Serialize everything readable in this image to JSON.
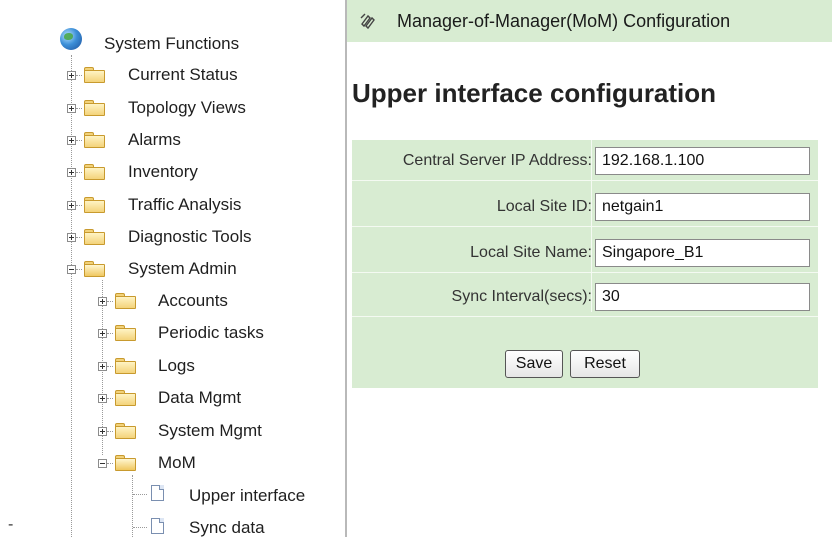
{
  "tree": {
    "root": "System Functions",
    "items": [
      {
        "label": "Current Status"
      },
      {
        "label": "Topology Views"
      },
      {
        "label": "Alarms"
      },
      {
        "label": "Inventory"
      },
      {
        "label": "Traffic Analysis"
      },
      {
        "label": "Diagnostic Tools"
      },
      {
        "label": "System Admin"
      }
    ],
    "system_admin_children": [
      {
        "label": "Accounts"
      },
      {
        "label": "Periodic tasks"
      },
      {
        "label": "Logs"
      },
      {
        "label": "Data Mgmt"
      },
      {
        "label": "System Mgmt"
      },
      {
        "label": "MoM"
      }
    ],
    "mom_children": [
      {
        "label": "Upper interface"
      },
      {
        "label": "Sync data"
      }
    ]
  },
  "header": {
    "title": "Manager-of-Manager(MoM) Configuration"
  },
  "page": {
    "heading": "Upper interface configuration"
  },
  "form": {
    "fields": [
      {
        "label": "Central Server IP Address:",
        "value": "192.168.1.100"
      },
      {
        "label": "Local Site ID:",
        "value": "netgain1"
      },
      {
        "label": "Local Site Name:",
        "value": "Singapore_B1"
      },
      {
        "label": "Sync Interval(secs):",
        "value": "30"
      }
    ],
    "save_label": "Save",
    "reset_label": "Reset"
  },
  "footer_mark": "-",
  "colors": {
    "panel_green": "#d8ecd2",
    "divider": "#b9b9b9"
  }
}
